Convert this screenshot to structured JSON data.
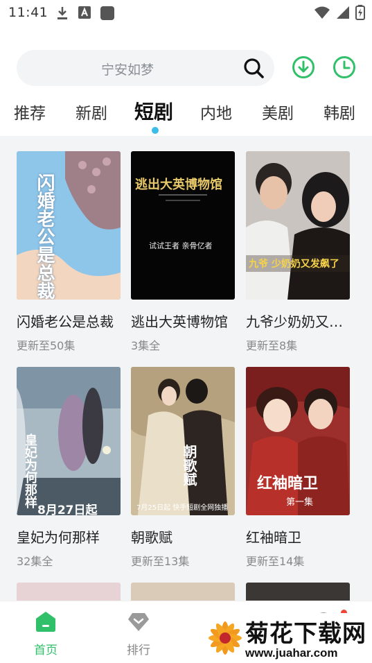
{
  "status_bar": {
    "time": "11:41"
  },
  "search": {
    "placeholder": "宁安如梦"
  },
  "tabs": [
    {
      "label": "推荐",
      "active": false
    },
    {
      "label": "新剧",
      "active": false
    },
    {
      "label": "短剧",
      "active": true
    },
    {
      "label": "内地",
      "active": false
    },
    {
      "label": "美剧",
      "active": false
    },
    {
      "label": "韩剧",
      "active": false
    }
  ],
  "dramas": [
    {
      "title": "闪婚老公是总裁",
      "status": "更新至50集",
      "poster_text": "闪婚老公是总裁"
    },
    {
      "title": "逃出大英博物馆",
      "status": "3集全",
      "poster_text": "逃出大英博物馆",
      "poster_subtext": "试试王者   亲骨亿者"
    },
    {
      "title": "九爷少奶奶又…",
      "status": "更新至8集",
      "poster_text": "九爷 少奶奶又发飙了"
    },
    {
      "title": "皇妃为何那样",
      "status": "32集全",
      "poster_text": "皇妃为何那样",
      "poster_subtext": "8月27日起"
    },
    {
      "title": "朝歌赋",
      "status": "更新至13集",
      "poster_text": "朝歌赋",
      "poster_subtext": "7月25日起 快手短剧全网独播"
    },
    {
      "title": "红袖暗卫",
      "status": "更新至14集",
      "poster_text": "红袖暗卫",
      "poster_subtext": "第一集"
    }
  ],
  "bottom_nav": [
    {
      "label": "首页",
      "icon": "home-icon",
      "active": true
    },
    {
      "label": "排行",
      "icon": "ranking-icon",
      "active": false
    }
  ],
  "watermark": {
    "title": "菊花下载网",
    "url": "www.juahar.com"
  },
  "colors": {
    "accent": "#30c06a",
    "tab_indicator": "#3bbde9",
    "content_bg": "#f3f4f6"
  }
}
